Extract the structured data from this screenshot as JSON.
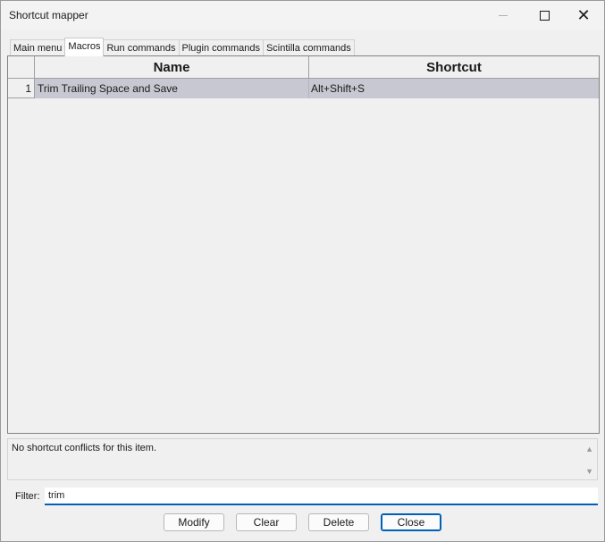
{
  "window": {
    "title": "Shortcut mapper",
    "minimize_icon": "minimize-icon",
    "maximize_icon": "maximize-icon",
    "close_icon": "close-icon",
    "close_glyph": "✕"
  },
  "tabs": [
    {
      "label": "Main menu",
      "active": false
    },
    {
      "label": "Macros",
      "active": true
    },
    {
      "label": "Run commands",
      "active": false
    },
    {
      "label": "Plugin commands",
      "active": false
    },
    {
      "label": "Scintilla commands",
      "active": false
    }
  ],
  "grid": {
    "columns": [
      "Name",
      "Shortcut"
    ],
    "rows": [
      {
        "index": "1",
        "name": "Trim Trailing Space and Save",
        "shortcut": "Alt+Shift+S",
        "selected": true
      }
    ],
    "selected_color": "#c8c8d2"
  },
  "conflict": {
    "message": "No shortcut conflicts for this item.",
    "scroll_up_glyph": "▲",
    "scroll_down_glyph": "▼"
  },
  "filter": {
    "label": "Filter:",
    "value": "trim"
  },
  "buttons": {
    "modify": "Modify",
    "clear": "Clear",
    "delete": "Delete",
    "close": "Close"
  },
  "colors": {
    "accent": "#005fb8",
    "window_bg": "#f0f0f0"
  }
}
